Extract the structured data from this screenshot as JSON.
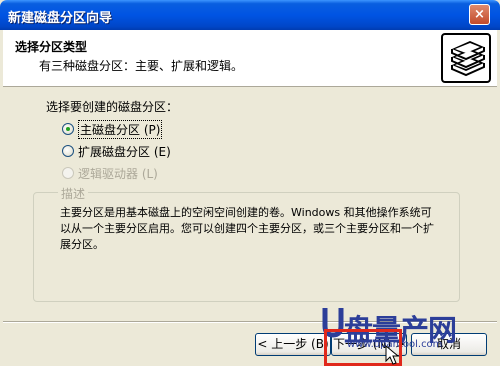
{
  "window": {
    "title": "新建磁盘分区向导",
    "close_label": "×"
  },
  "header": {
    "title": "选择分区类型",
    "subtitle": "有三种磁盘分区：主要、扩展和逻辑。",
    "icon": "disk-stack-icon"
  },
  "body": {
    "prompt": "选择要创建的磁盘分区：",
    "options": [
      {
        "label": "主磁盘分区 (P)",
        "selected": true,
        "enabled": true
      },
      {
        "label": "扩展磁盘分区 (E)",
        "selected": false,
        "enabled": true
      },
      {
        "label": "逻辑驱动器 (L)",
        "selected": false,
        "enabled": false
      }
    ],
    "description": {
      "legend": "描述",
      "text": "主要分区是用基本磁盘上的空闲空间创建的卷。Windows 和其他操作系统可以从一个主要分区启用。您可以创建四个主要分区，或三个主要分区和一个扩展分区。"
    }
  },
  "buttons": {
    "back": "< 上一步 (B)",
    "next": "下一步 (N) >",
    "cancel": "取消"
  },
  "watermark": {
    "brand": "盘量产网",
    "url": "www.upantool.com"
  },
  "colors": {
    "titlebar": "#0054e3",
    "dialog_bg": "#ece9d8",
    "watermark": "#2c3e99",
    "highlight_box": "#e0281b"
  }
}
